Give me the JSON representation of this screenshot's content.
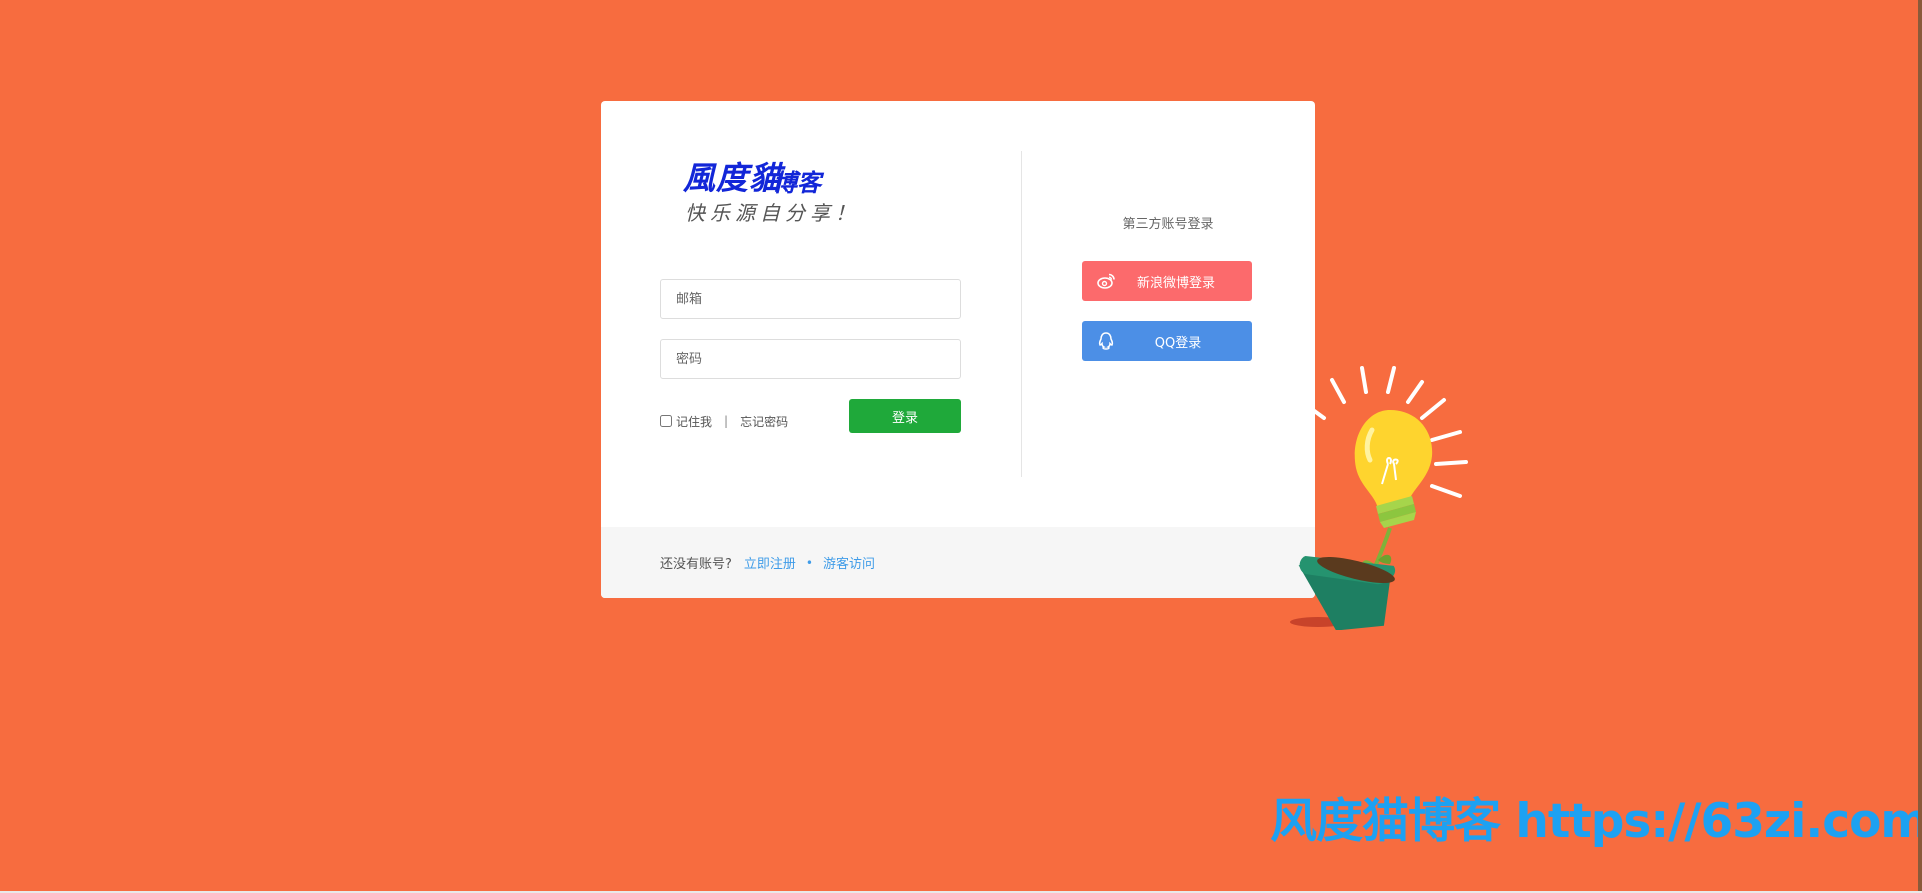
{
  "logo": {
    "title": "風度貓",
    "title_small": "博客",
    "slogan": "快乐源自分享！"
  },
  "form": {
    "email_placeholder": "邮箱",
    "password_placeholder": "密码",
    "remember_label": "记住我",
    "separator": "|",
    "forgot_label": "忘记密码",
    "login_label": "登录"
  },
  "third_party": {
    "title": "第三方账号登录",
    "weibo_label": "新浪微博登录",
    "qq_label": "QQ登录"
  },
  "footer": {
    "no_account": "还没有账号?",
    "register": "立即注册",
    "dot": "•",
    "guest": "游客访问"
  },
  "watermark": "风度猫博客 https://63zi.com",
  "colors": {
    "background": "#f76c3f",
    "login_button": "#1fa93a",
    "weibo": "#fc6a6c",
    "qq": "#4c8fe6",
    "link": "#3f9ce8",
    "logo": "#1226d8",
    "watermark": "#1da1f2"
  }
}
